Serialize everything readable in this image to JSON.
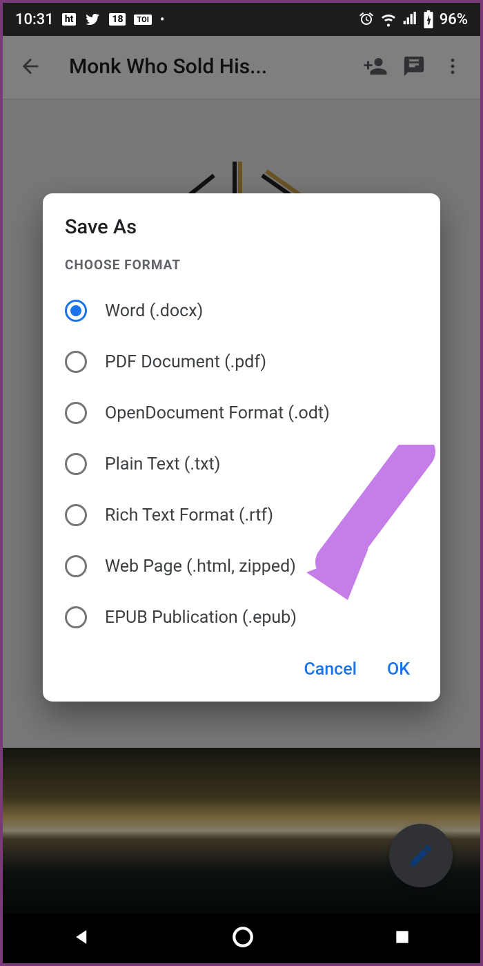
{
  "statusbar": {
    "time": "10:31",
    "left_icons": [
      "ht",
      "twitter",
      "18",
      "TOI",
      "dot"
    ],
    "battery_pct": "96%"
  },
  "header": {
    "title": "Monk Who Sold His..."
  },
  "dialog": {
    "title": "Save As",
    "subtitle": "CHOOSE FORMAT",
    "options": [
      {
        "label": "Word (.docx)",
        "selected": true
      },
      {
        "label": "PDF Document (.pdf)",
        "selected": false
      },
      {
        "label": "OpenDocument Format (.odt)",
        "selected": false
      },
      {
        "label": "Plain Text (.txt)",
        "selected": false
      },
      {
        "label": "Rich Text Format (.rtf)",
        "selected": false
      },
      {
        "label": "Web Page (.html, zipped)",
        "selected": false
      },
      {
        "label": "EPUB Publication (.epub)",
        "selected": false
      }
    ],
    "cancel_label": "Cancel",
    "ok_label": "OK"
  }
}
